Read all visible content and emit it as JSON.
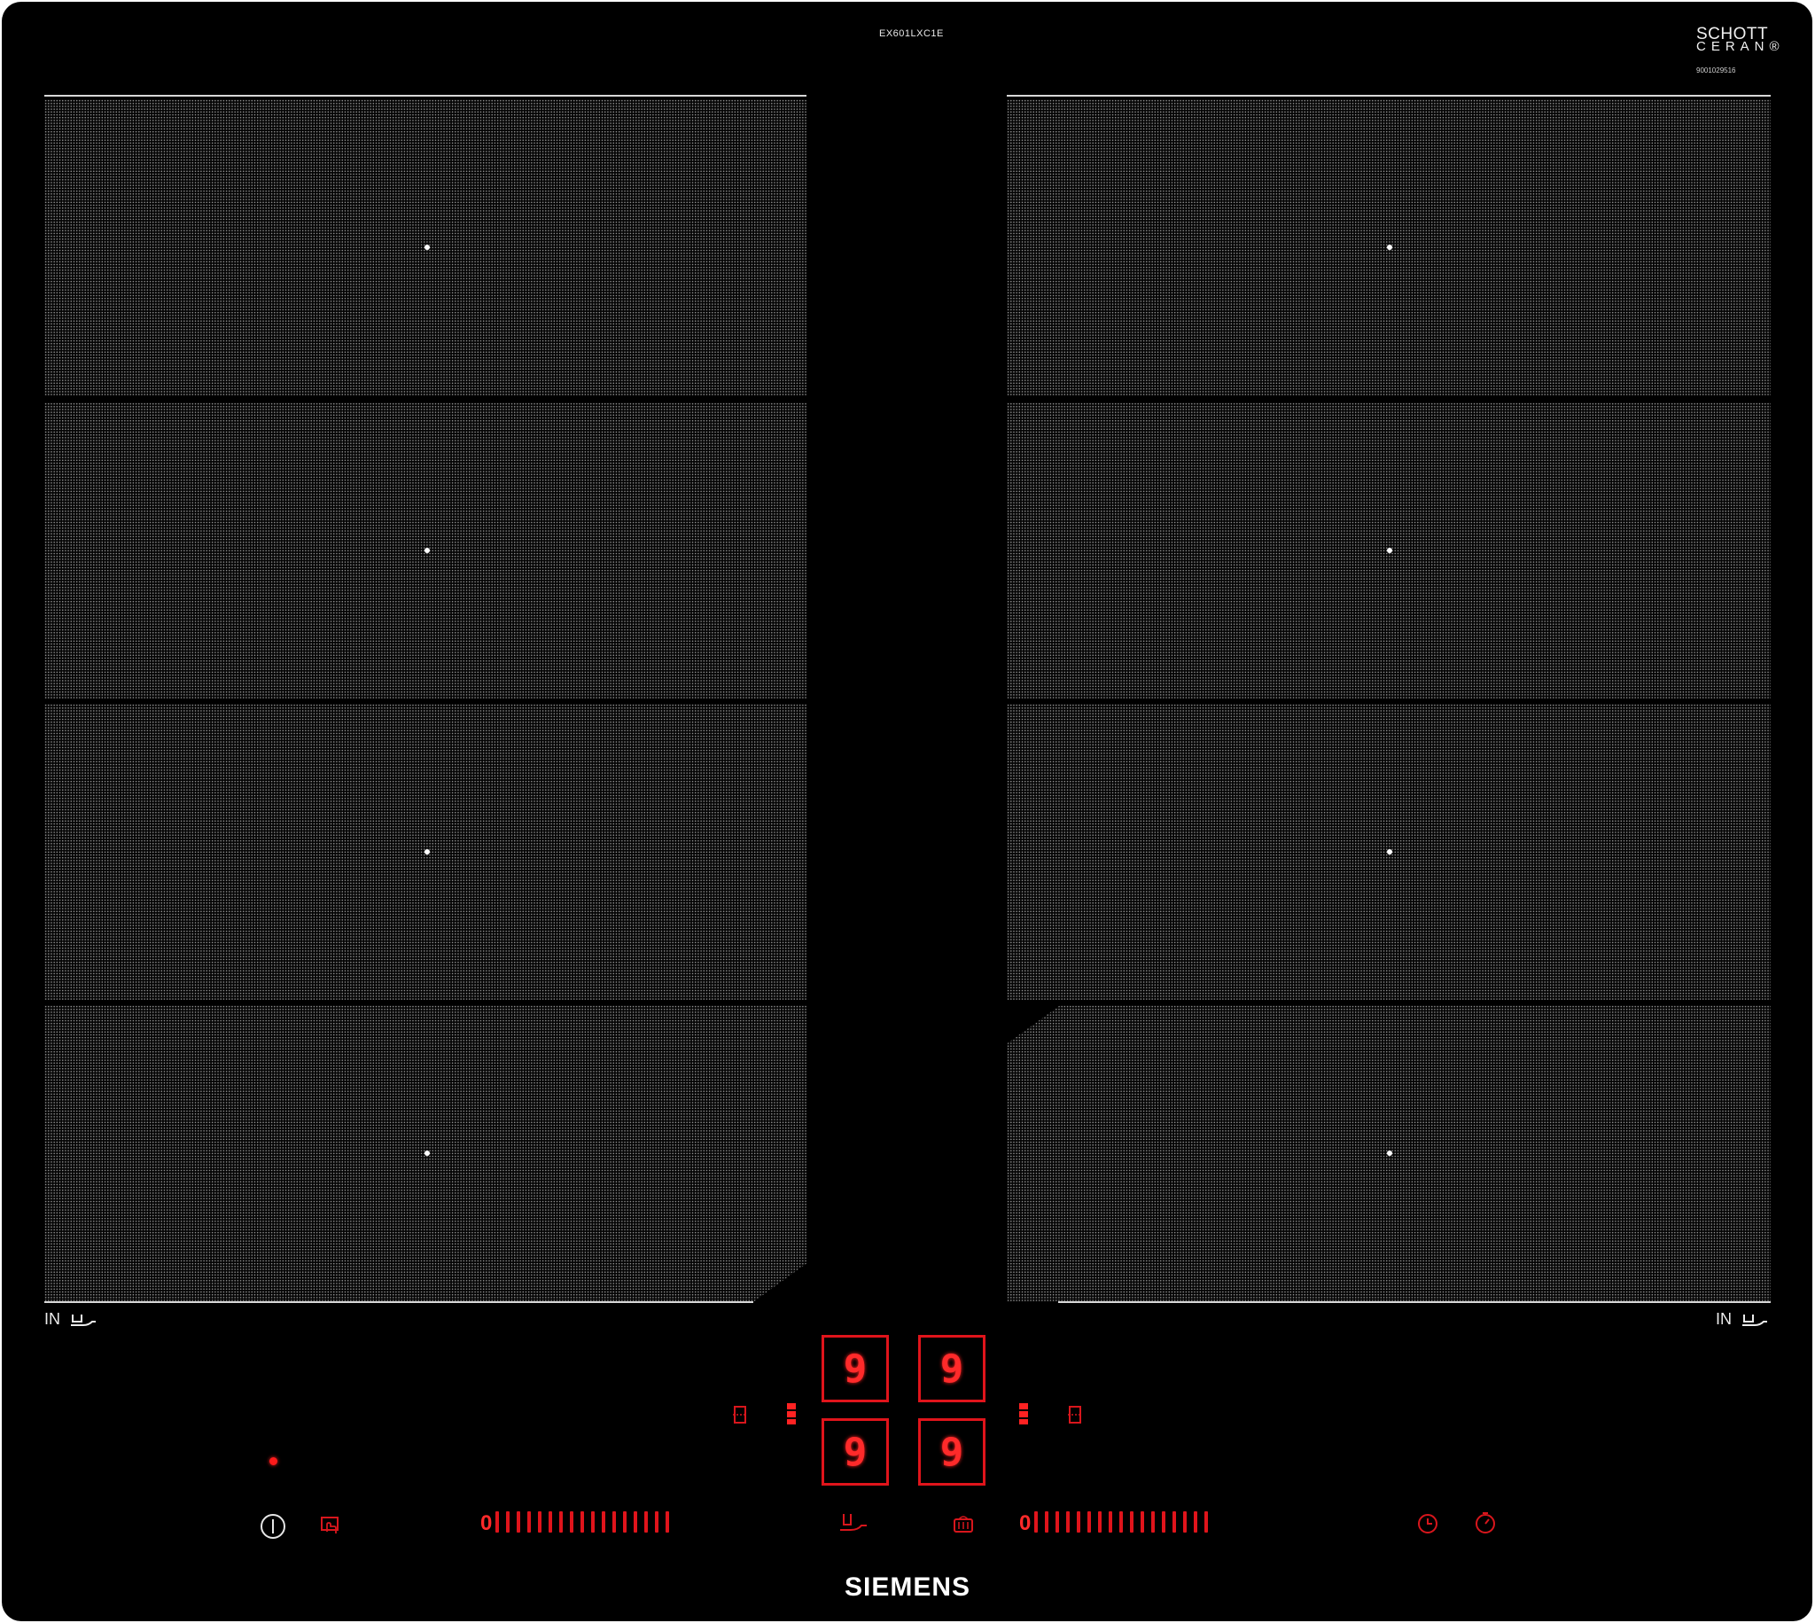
{
  "labels": {
    "model_number": "EX601LXC1E",
    "glass_brand_line1": "SCHOTT",
    "glass_brand_line2": "CERAN®",
    "serial_number": "9001029516",
    "induction_left": "IN",
    "induction_right": "IN",
    "brand": "SIEMENS"
  },
  "displays": {
    "front_left": "9",
    "front_right": "9",
    "rear_left": "9",
    "rear_right": "9"
  },
  "sliders": {
    "left": {
      "zero_label": "0",
      "positions": 17,
      "level": 0
    },
    "right": {
      "zero_label": "0",
      "positions": 17,
      "level": 0
    }
  },
  "icons": {
    "power": "power-icon",
    "child_lock": "child-lock-icon",
    "wipe_protection": "wipe-protection-icon",
    "frying_sensor": "frying-sensor-icon",
    "flex_zone": "flex-zone-icon",
    "zone_select": "zone-select-icon",
    "timer": "clock-icon",
    "stopwatch": "stopwatch-icon"
  },
  "colors": {
    "glass": "#000000",
    "zone_dots": "#8f8f8f",
    "display_red": "#e0141b",
    "text_white": "#ffffff"
  }
}
